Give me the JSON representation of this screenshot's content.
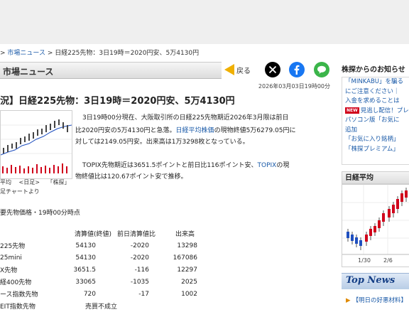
{
  "breadcrumb": [
    "> ",
    "市場ニュース",
    " > ",
    "日経225先物：3日19時＝2020円安、5万4130円"
  ],
  "section": {
    "title": "市場ニュース"
  },
  "back_label": "戻る",
  "share": [
    "x-icon",
    "facebook-icon",
    "line-icon"
  ],
  "article": {
    "timestamp": "2026年03月03日19時00分",
    "headline": "況】日経225先物：3日19時＝2020円安、5万4130円",
    "para1": {
      "l1": "3日19時00分現在、大阪取引所の日経225先物期近2026年3月限は前日",
      "l2": "比2020円安の5万4130円と急落。",
      "l2_link": "日経平均株価",
      "l2_tail": "の現物終値5万6279.05円に",
      "l3": "対しては2149.05円安。出来高は1万3298枚となっている。"
    },
    "para2": {
      "l1_a": "TOPIX先物期近は3651.5ポイントと前日比116ポイント安、",
      "l1_link": "TOPIX",
      "l1_b": "の現",
      "l2": "物終値比は120.67ポイント安で推移。"
    },
    "chart_tabs": [
      "平均",
      "<日足>",
      "「株探」"
    ],
    "chart_caption": "足チャートより",
    "table_title": "要先物価格・19時00分時点",
    "table_headers": [
      "清算値(終値)",
      "前日清算値比",
      "出来高"
    ],
    "rows": [
      [
        "225先物",
        "54130",
        "-2020",
        "13298"
      ],
      [
        "25mini",
        "54130",
        "-2020",
        "167086"
      ],
      [
        "X先物",
        "3651.5",
        "-116",
        "12297"
      ],
      [
        "経400先物",
        "33065",
        "-1035",
        "2025"
      ],
      [
        "ース指数先物",
        "720",
        "-17",
        "1002"
      ],
      [
        "EIT指数先物",
        "売買不成立",
        "",
        ""
      ]
    ]
  },
  "right": {
    "head": "株探からのお知らせ",
    "news": {
      "n1": "「MINKABU」を騙る",
      "n2": "にご注意ください｜",
      "n3": "入金を求めることは",
      "n4_badge": "NEW",
      "n4": "見逃し配信！プレ",
      "n5": "パソコン版「お気に",
      "n6": "追加",
      "n7": "「お気に入り銘柄」",
      "n8": "「株探プレミアム」"
    },
    "avg_title": "日経平均",
    "avg_xticks": [
      "1/30",
      "2/6"
    ],
    "topnews_label": "Top News",
    "topnews_item": "【明日の好悪材料】"
  },
  "colors": {
    "link": "#1a5aa8",
    "up": "#d0021b",
    "down": "#1f4fbf",
    "back_arrow": "#f0b000"
  }
}
